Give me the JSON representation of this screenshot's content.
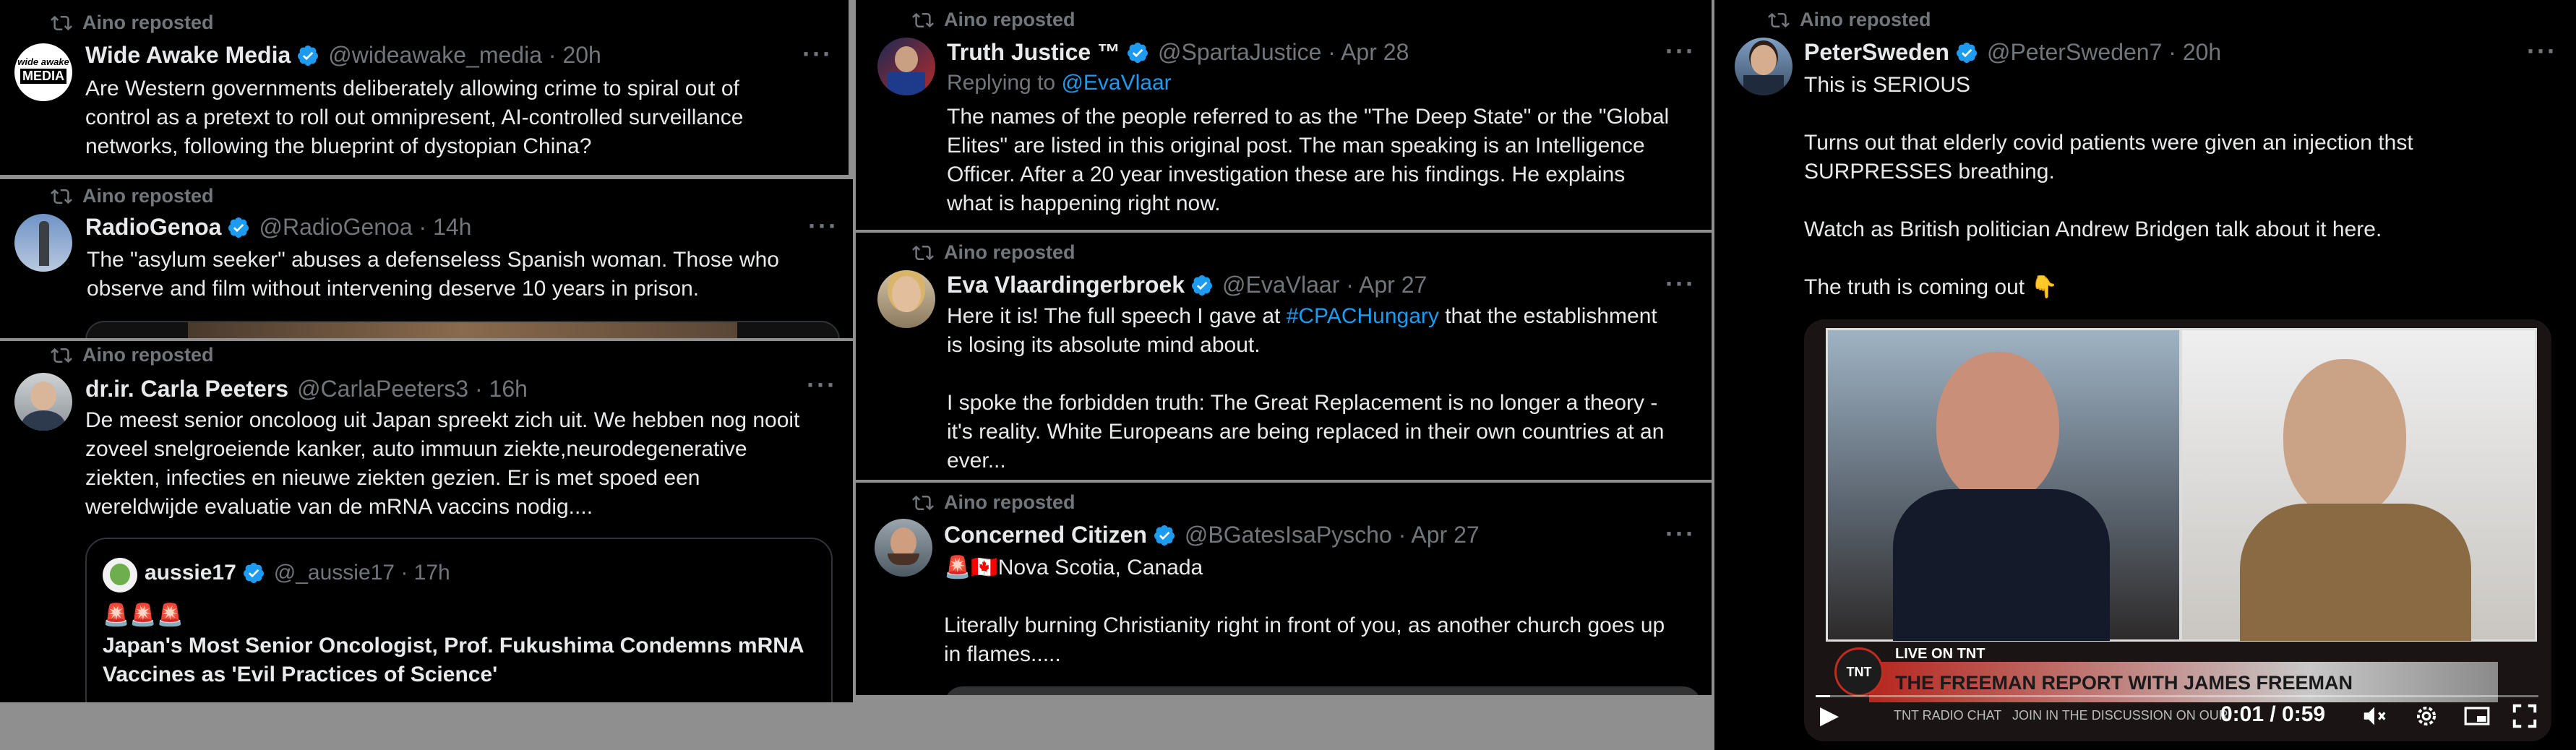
{
  "repost_label": "Aino reposted",
  "col1": {
    "post1": {
      "name": "Wide Awake Media",
      "handle": "@wideawake_media · 20h",
      "avatar_text_top": "wide awake",
      "avatar_text_main": "MEDIA",
      "text": "Are Western governments deliberately allowing crime to spiral out of\ncontrol as a pretext to roll out omnipresent, AI-controlled surveillance\nnetworks, following the blueprint of dystopian China?"
    },
    "post2": {
      "name": "RadioGenoa",
      "handle": "@RadioGenoa · 14h",
      "text": "The \"asylum seeker\" abuses a defenseless Spanish woman. Those who\nobserve and film without intervening deserve 10 years in prison."
    },
    "post3": {
      "name": "dr.ir. Carla Peeters",
      "handle": "@CarlaPeeters3 · 16h",
      "text": "De meest senior oncoloog uit Japan spreekt zich uit. We hebben nog nooit\nzoveel snelgroeiende kanker, auto immuun ziekte,neurodegenerative\nziekten, infecties en nieuwe ziekten gezien. Er is met spoed een\nwereldwijde evaluatie van de mRNA vaccins nodig....",
      "quote": {
        "name": "aussie17",
        "handle": "@_aussie17 · 17h",
        "emojis": "🚨🚨🚨",
        "text": "Japan's Most Senior Oncologist, Prof. Fukushima Condemns mRNA\nVaccines as 'Evil Practices of Science'"
      }
    }
  },
  "col2": {
    "post1": {
      "name": "Truth Justice ™",
      "handle": "@SpartaJustice · Apr 28",
      "replying_prefix": "Replying to ",
      "replying_handle": "@EvaVlaar",
      "text": "The names of the people referred to as the \"The Deep State\" or the \"Global\nElites\" are listed in this original post. The man speaking is an Intelligence\nOfficer. After a 20 year investigation these are his findings. He explains\nwhat is happening right now."
    },
    "post2": {
      "name": "Eva Vlaardingerbroek",
      "handle": "@EvaVlaar · Apr 27",
      "text_before": "Here it is! The full speech I gave at ",
      "hashtag": "#CPACHungary",
      "text_after": " that the establishment\nis losing its absolute mind about.\n\nI spoke the forbidden truth: The Great Replacement is no longer a theory -\nit's reality. White Europeans are being replaced in their own countries at an\never..."
    },
    "post3": {
      "name": "Concerned Citizen",
      "handle": "@BGatesIsaPyscho · Apr 27",
      "location": "🚨🇨🇦Nova Scotia, Canada",
      "text": "Literally burning Christianity right in front of you, as another church goes up\nin flames....."
    }
  },
  "col3": {
    "post1": {
      "name": "PeterSweden",
      "handle": "@PeterSweden7 · 20h",
      "text": "This is SERIOUS\n\nTurns out that elderly covid patients were given an injection thst\nSURPRESSES breathing.\n\nWatch as British politician Andrew Bridgen talk about it here.\n\nThe truth is coming out 👇",
      "video": {
        "live_label": "LIVE ON TNT",
        "show_title": "THE FREEMAN REPORT WITH JAMES FREEMAN",
        "ticker": "TNT RADIO CHAT   JOIN IN THE DISCUSSION ON OUR",
        "logo": "TNT",
        "time": "0:01 / 0:59"
      }
    }
  },
  "colors": {
    "background": "#000000",
    "separator": "#8f8f8f",
    "text": "#e7e9ea",
    "muted": "#71767b",
    "link": "#1d9bf0",
    "verified": "#1d9bf0"
  },
  "icons": [
    "repost-icon",
    "verified-badge-icon",
    "more-options-icon",
    "play-icon",
    "volume-mute-icon",
    "settings-icon",
    "pip-icon",
    "fullscreen-icon"
  ]
}
